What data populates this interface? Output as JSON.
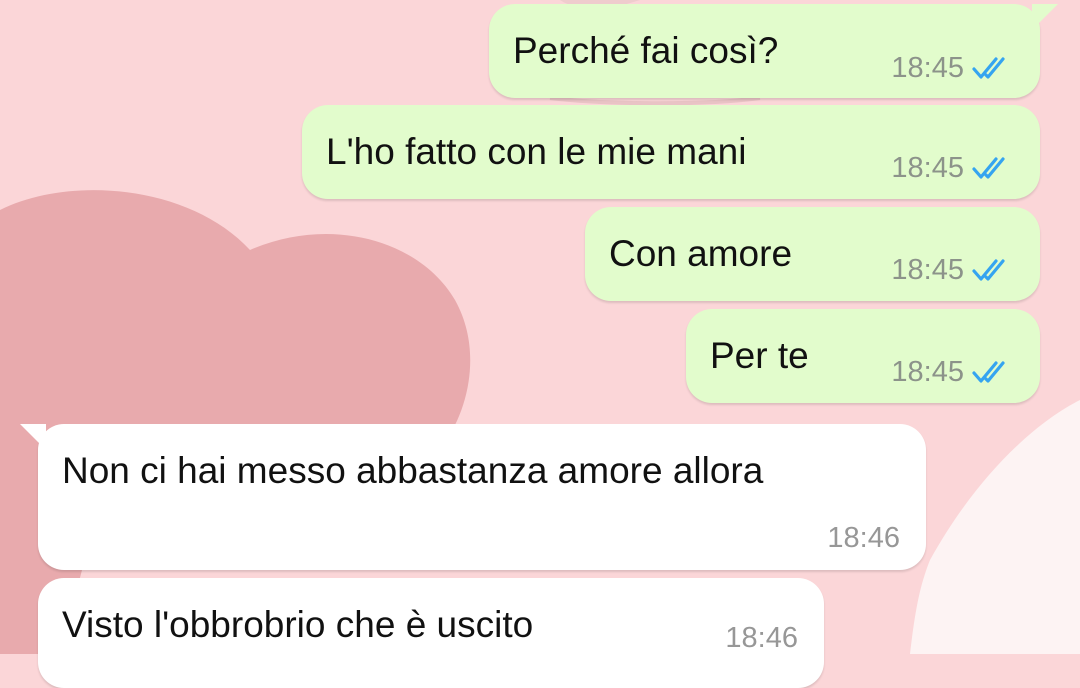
{
  "messages": [
    {
      "direction": "out",
      "text": "Perché fai così?",
      "time": "18:45",
      "status": "read",
      "status_icon": "double-check-icon"
    },
    {
      "direction": "out",
      "text": "L'ho fatto con le mie mani",
      "time": "18:45",
      "status": "read",
      "status_icon": "double-check-icon"
    },
    {
      "direction": "out",
      "text": "Con amore",
      "time": "18:45",
      "status": "read",
      "status_icon": "double-check-icon"
    },
    {
      "direction": "out",
      "text": "Per te",
      "time": "18:45",
      "status": "read",
      "status_icon": "double-check-icon"
    },
    {
      "direction": "in",
      "text": "Non ci hai messo abbastanza amore allora",
      "time": "18:46"
    },
    {
      "direction": "in",
      "text": "Visto l'obbrobrio che è uscito",
      "time": "18:46"
    }
  ],
  "colors": {
    "background": "#fbd6d8",
    "outgoing_bubble": "#e2fccc",
    "incoming_bubble": "#ffffff",
    "read_ticks": "#35a4f0",
    "timestamp": "#8c938a"
  }
}
